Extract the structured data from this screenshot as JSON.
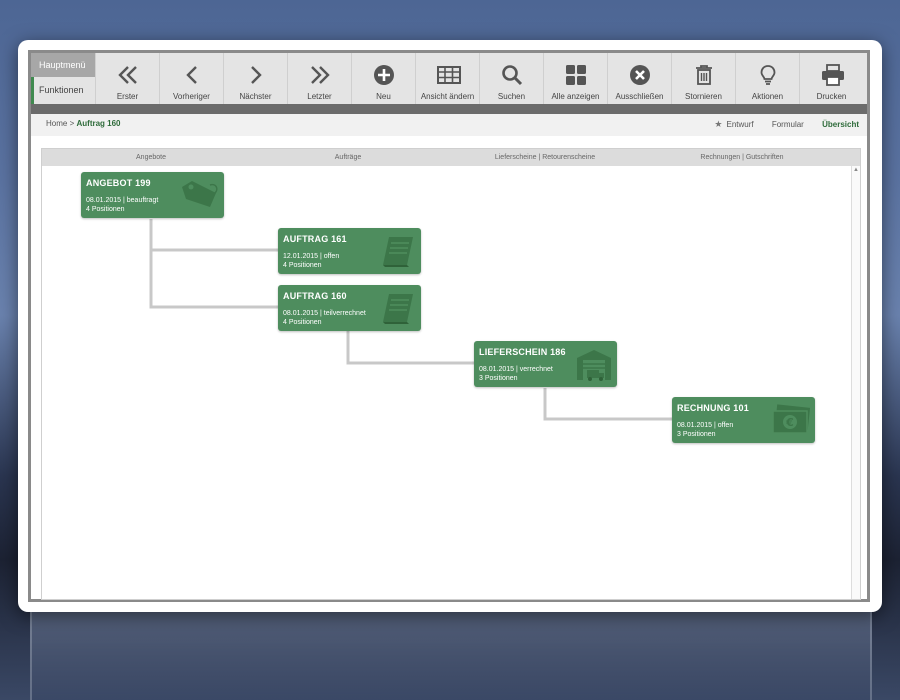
{
  "menu": {
    "main_label": "Hauptmenü",
    "functions_label": "Funktionen"
  },
  "toolbar": [
    {
      "label": "Erster",
      "icon": "double-chevron-left-icon"
    },
    {
      "label": "Vorheriger",
      "icon": "chevron-left-icon"
    },
    {
      "label": "Nächster",
      "icon": "chevron-right-icon"
    },
    {
      "label": "Letzter",
      "icon": "double-chevron-right-icon"
    },
    {
      "label": "Neu",
      "icon": "plus-circle-icon"
    },
    {
      "label": "Ansicht ändern",
      "icon": "table-grid-icon"
    },
    {
      "label": "Suchen",
      "icon": "search-icon"
    },
    {
      "label": "Alle anzeigen",
      "icon": "tiles-icon"
    },
    {
      "label": "Ausschließen",
      "icon": "x-circle-icon"
    },
    {
      "label": "Stornieren",
      "icon": "trash-icon"
    },
    {
      "label": "Aktionen",
      "icon": "lightbulb-icon"
    },
    {
      "label": "Drucken",
      "icon": "printer-icon"
    }
  ],
  "breadcrumb": {
    "home": "Home",
    "separator": ">",
    "current": "Auftrag 160"
  },
  "views": {
    "draft": "Entwurf",
    "form": "Formular",
    "overview": "Übersicht"
  },
  "columns": [
    "Angebote",
    "Aufträge",
    "Lieferscheine | Retourenscheine",
    "Rechnungen | Gutschriften"
  ],
  "documents": [
    {
      "title": "ANGEBOT 199",
      "date": "08.01.2015",
      "status": "beauftragt",
      "positions": "4 Positionen",
      "icon": "price-tag-icon"
    },
    {
      "title": "AUFTRAG 161",
      "date": "12.01.2015",
      "status": "offen",
      "positions": "4 Positionen",
      "icon": "book-icon"
    },
    {
      "title": "AUFTRAG 160",
      "date": "08.01.2015",
      "status": "teilverrechnet",
      "positions": "4 Positionen",
      "icon": "book-icon"
    },
    {
      "title": "LIEFERSCHEIN 186",
      "date": "08.01.2015",
      "status": "verrechnet",
      "positions": "3 Positionen",
      "icon": "warehouse-truck-icon"
    },
    {
      "title": "RECHNUNG 101",
      "date": "08.01.2015",
      "status": "offen",
      "positions": "3 Positionen",
      "icon": "euro-banknote-icon"
    }
  ],
  "colors": {
    "card": "#4e8d5e",
    "accent": "#2e6b3a",
    "connector": "#c8c8c8"
  }
}
